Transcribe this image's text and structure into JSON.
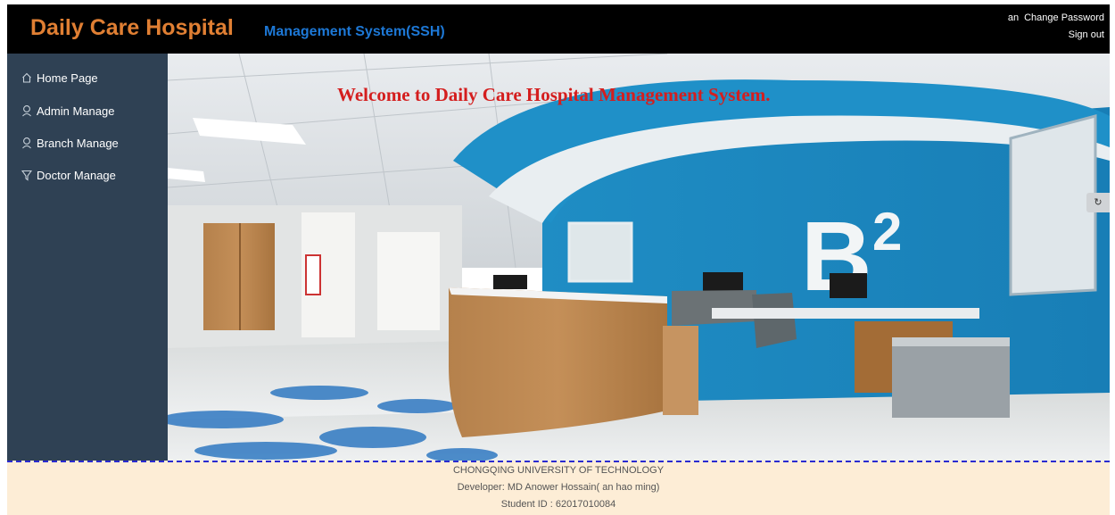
{
  "header": {
    "title": "Daily Care Hospital",
    "subtitle": "Management System(SSH)",
    "username": "an",
    "change_password": "Change Password",
    "sign_out": "Sign out"
  },
  "sidebar": {
    "items": [
      {
        "label": "Home Page",
        "icon": "home-icon"
      },
      {
        "label": "Admin Manage",
        "icon": "user-icon"
      },
      {
        "label": "Branch Manage",
        "icon": "user-icon"
      },
      {
        "label": "Doctor Manage",
        "icon": "filter-icon"
      }
    ]
  },
  "main": {
    "welcome": "Welcome to Daily Care Hospital Management System.",
    "side_tab_glyph": "↻"
  },
  "footer": {
    "line1": "CHONGQING UNIVERSITY OF TECHNOLOGY",
    "line2": "Developer: MD Anower Hossain( an hao ming)",
    "line3": "Student ID : 62017010084"
  },
  "colors": {
    "header_bg": "#000000",
    "brand_orange": "#e07f33",
    "brand_blue": "#1d78d6",
    "sidebar_bg": "#2f4154",
    "welcome_red": "#d41e1e",
    "footer_bg": "#fdedd6",
    "footer_border": "#2a2ad0"
  }
}
